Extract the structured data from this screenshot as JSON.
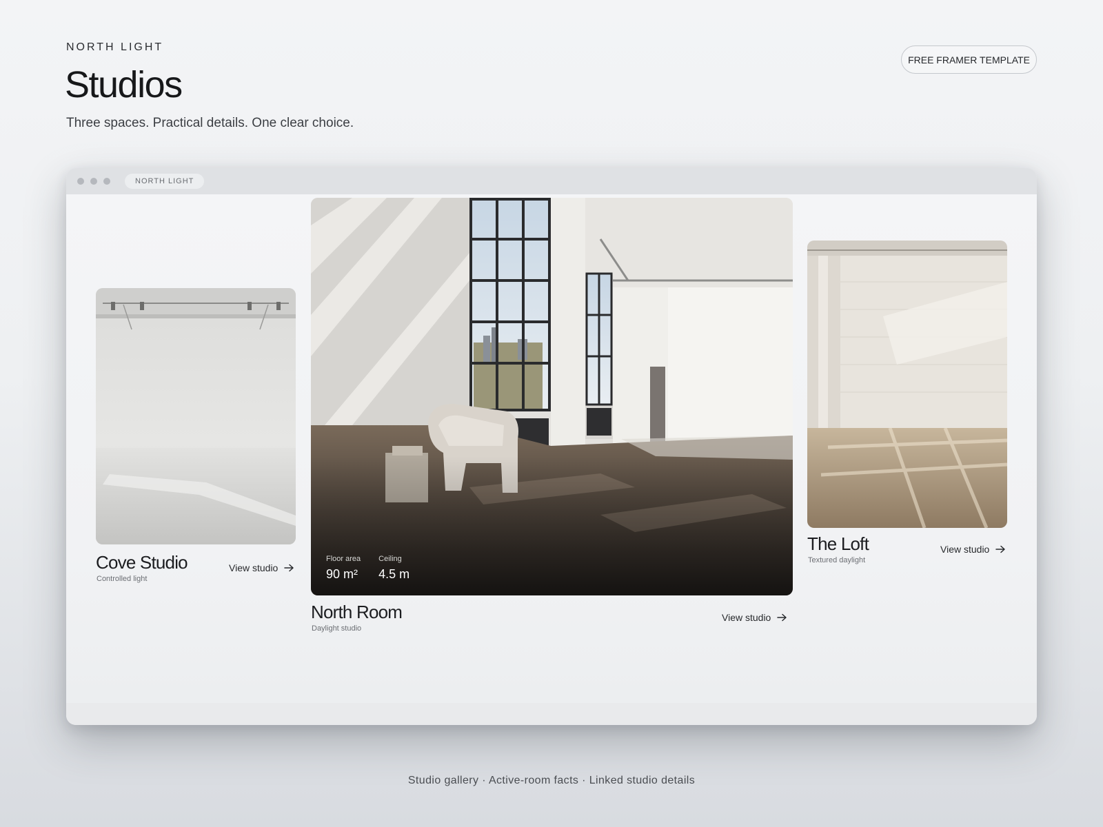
{
  "header": {
    "brand": "NORTH LIGHT",
    "title": "Studios",
    "subtitle": "Three spaces. Practical details. One clear choice.",
    "template_button": "FREE FRAMER TEMPLATE"
  },
  "browser": {
    "tab_label": "NORTH LIGHT"
  },
  "studios": [
    {
      "name": "Cove Studio",
      "subtitle": "Controlled light",
      "link": "View studio",
      "photo": "white cyclorama studio with track lights"
    },
    {
      "name": "North Room",
      "subtitle": "Daylight studio",
      "link": "View studio",
      "photo": "loft studio with tall windows, armchair and wooden floor",
      "facts": [
        {
          "label": "Floor area",
          "value": "90 m²"
        },
        {
          "label": "Ceiling",
          "value": "4.5 m"
        }
      ]
    },
    {
      "name": "The Loft",
      "subtitle": "Textured daylight",
      "link": "View studio",
      "photo": "white brick wall with sunlit wooden floor"
    }
  ],
  "caption": "Studio gallery · Active-room facts · Linked studio details",
  "icons": {
    "link_icon": "arrow-right-icon"
  },
  "colors": {
    "text": "#1d1f22",
    "background": "#eef0f2",
    "browser_bar": "#dfe1e4"
  }
}
